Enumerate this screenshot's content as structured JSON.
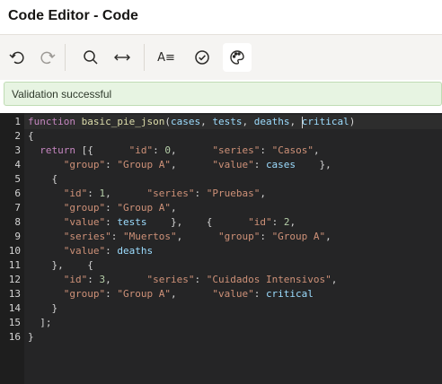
{
  "header": {
    "title": "Code Editor - Code"
  },
  "toolbar": {
    "buttons": [
      {
        "name": "undo-icon",
        "enabled": true
      },
      {
        "name": "redo-icon",
        "enabled": false
      },
      {
        "name": "search-icon",
        "enabled": true
      },
      {
        "name": "replace-arrows-icon",
        "enabled": true
      },
      {
        "name": "text-format-icon",
        "enabled": true,
        "label": "A≡"
      },
      {
        "name": "validate-check-icon",
        "enabled": true
      },
      {
        "name": "theme-palette-icon",
        "enabled": true
      }
    ]
  },
  "status": {
    "message": "Validation successful"
  },
  "colors": {
    "keyword": "#c586c0",
    "function": "#dcdcaa",
    "param": "#9cdcfe",
    "string": "#ce9178",
    "number": "#b5cea8",
    "plain": "#d4d4d4"
  },
  "editor": {
    "lines": [
      {
        "n": "1",
        "text": "function basic_pie_json(cases, tests, deaths, critical)"
      },
      {
        "n": "2",
        "text": "{"
      },
      {
        "n": "3",
        "text": "  return [{      \"id\": 0,      \"series\": \"Casos\","
      },
      {
        "n": "4",
        "text": "      \"group\": \"Group A\",      \"value\": cases    },"
      },
      {
        "n": "5",
        "text": "    {"
      },
      {
        "n": "6",
        "text": "      \"id\": 1,      \"series\": \"Pruebas\","
      },
      {
        "n": "7",
        "text": "      \"group\": \"Group A\","
      },
      {
        "n": "8",
        "text": "      \"value\": tests    },    {      \"id\": 2,"
      },
      {
        "n": "9",
        "text": "      \"series\": \"Muertos\",      \"group\": \"Group A\","
      },
      {
        "n": "10",
        "text": "      \"value\": deaths"
      },
      {
        "n": "11",
        "text": "    },    {"
      },
      {
        "n": "12",
        "text": "      \"id\": 3,      \"series\": \"Cuidados Intensivos\","
      },
      {
        "n": "13",
        "text": "      \"group\": \"Group A\",      \"value\": critical"
      },
      {
        "n": "14",
        "text": "    }"
      },
      {
        "n": "15",
        "text": "  ];"
      },
      {
        "n": "16",
        "text": "}"
      }
    ]
  }
}
